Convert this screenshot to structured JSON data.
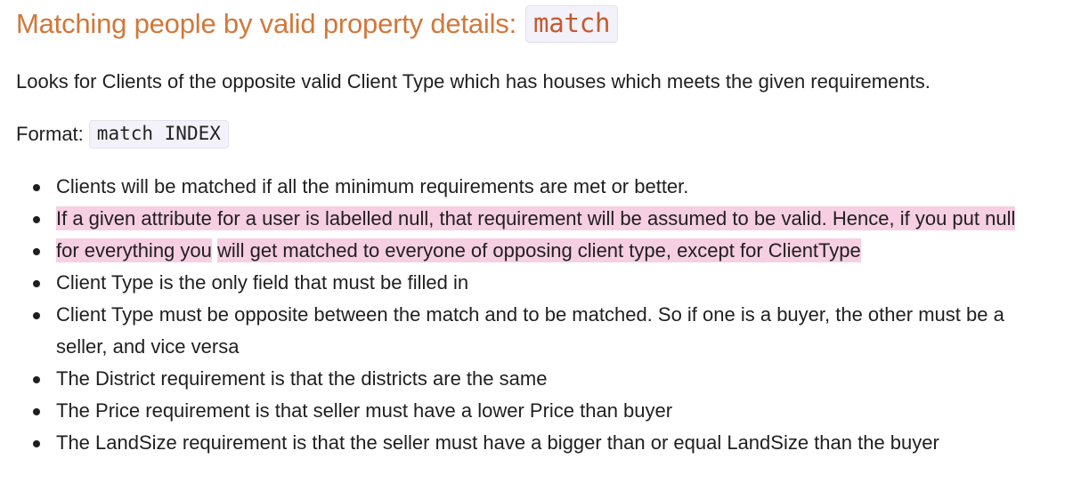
{
  "heading": {
    "text": "Matching people by valid property details:",
    "code": "match"
  },
  "intro": "Looks for Clients of the opposite valid Client Type which has houses which meets the given requirements.",
  "format": {
    "label": "Format:",
    "code": "match INDEX"
  },
  "bullets": [
    {
      "parts": [
        "Clients will be matched if all the minimum requirements are met or better."
      ],
      "highlight": false
    },
    {
      "parts": [
        "If a given attribute for a user is labelled null, that requirement will be assumed to be valid. Hence, if you put null"
      ],
      "highlight": true
    },
    {
      "parts": [
        "for everything you",
        "will get matched to everyone of opposing client type, except for ClientType"
      ],
      "highlight": true
    },
    {
      "parts": [
        "Client Type is the only field that must be filled in"
      ],
      "highlight": false
    },
    {
      "parts": [
        "Client Type must be opposite between the match and to be matched. So if one is a buyer, the other must be a seller, and vice versa"
      ],
      "highlight": false
    },
    {
      "parts": [
        "The District requirement is that the districts are the same"
      ],
      "highlight": false
    },
    {
      "parts": [
        "The Price requirement is that seller must have a lower Price than buyer"
      ],
      "highlight": false
    },
    {
      "parts": [
        "The LandSize requirement is that the seller must have a bigger than or equal LandSize than the buyer"
      ],
      "highlight": false
    }
  ],
  "colors": {
    "heading": "#d2773a",
    "highlight": "#f6cfe2",
    "code_background": "#f3f2fa"
  }
}
